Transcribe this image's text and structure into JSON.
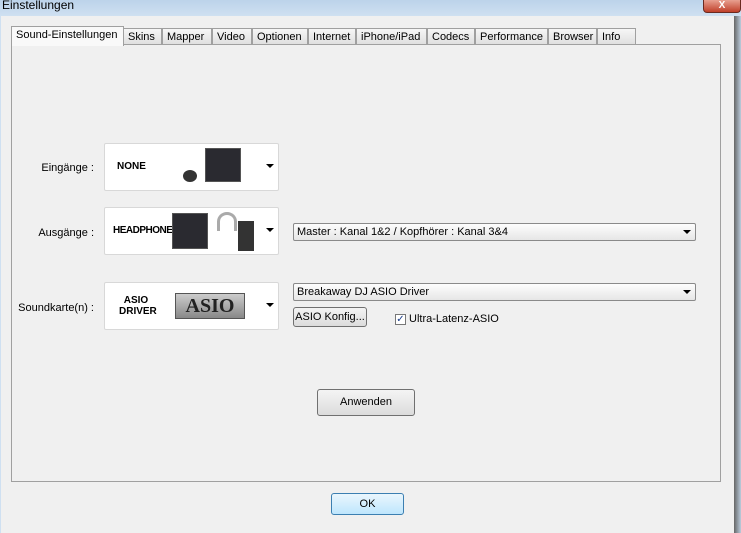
{
  "window": {
    "title": "Einstellungen",
    "close": "X"
  },
  "tabs": [
    "Sound-Einstellungen",
    "Skins",
    "Mapper",
    "Video",
    "Optionen",
    "Internet",
    "iPhone/iPad",
    "Codecs",
    "Performance",
    "Browser",
    "Info"
  ],
  "inputs": {
    "label": "Eingänge :",
    "value": "NONE"
  },
  "outputs": {
    "label": "Ausgänge :",
    "value": "HEADPHONES",
    "routing": "Master : Kanal 1&2 / Kopfhörer : Kanal 3&4"
  },
  "soundcard": {
    "label": "Soundkarte(n) :",
    "value_line1": "ASIO",
    "value_line2": "DRIVER",
    "logo": "ASIO",
    "driver": "Breakaway DJ ASIO Driver",
    "config_button": "ASIO Konfig...",
    "ultra_latency_label": "Ultra-Latenz-ASIO",
    "ultra_latency_checked": true
  },
  "apply_button": "Anwenden",
  "ok_button": "OK"
}
